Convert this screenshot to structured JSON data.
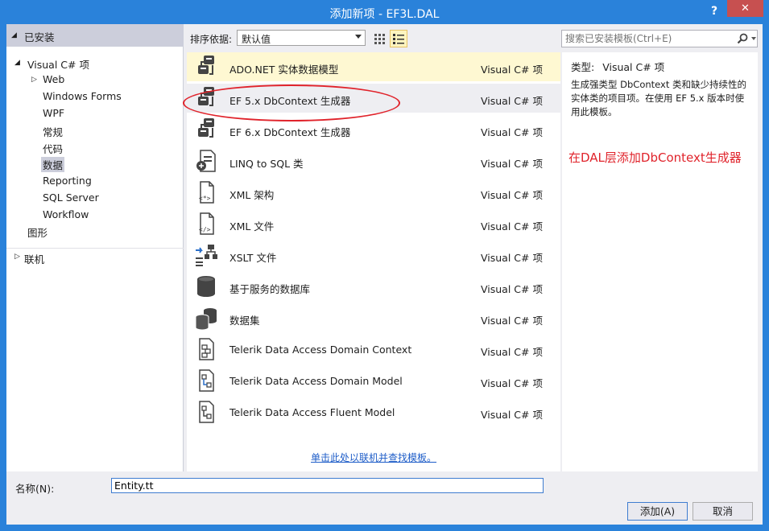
{
  "window": {
    "title": "添加新项 - EF3L.DAL",
    "help": "?",
    "close": "✕",
    "accent_color": "#2a82da"
  },
  "tree": {
    "installed_header": "已安装",
    "items": [
      {
        "label": "Visual C# 项",
        "expanded": true
      },
      {
        "label": "Web",
        "collapsed": true
      },
      {
        "label": "Windows Forms"
      },
      {
        "label": "WPF"
      },
      {
        "label": "常规"
      },
      {
        "label": "代码"
      },
      {
        "label": "数据",
        "selected": true
      },
      {
        "label": "Reporting"
      },
      {
        "label": "SQL Server"
      },
      {
        "label": "Workflow"
      },
      {
        "label": "图形"
      }
    ],
    "online_header": "联机"
  },
  "toolbar": {
    "sort_label": "排序依据:",
    "sort_value": "默认值",
    "search_placeholder": "搜索已安装模板(Ctrl+E)"
  },
  "templates": [
    {
      "name": "ADO.NET 实体数据模型",
      "lang": "Visual C# 项",
      "icon": "entity-model-icon"
    },
    {
      "name": "EF 5.x DbContext 生成器",
      "lang": "Visual C# 项",
      "icon": "dbcontext-generator-icon"
    },
    {
      "name": "EF 6.x DbContext 生成器",
      "lang": "Visual C# 项",
      "icon": "dbcontext-generator-icon"
    },
    {
      "name": "LINQ to SQL 类",
      "lang": "Visual C# 项",
      "icon": "linq-to-sql-icon"
    },
    {
      "name": "XML 架构",
      "lang": "Visual C# 项",
      "icon": "xml-schema-icon"
    },
    {
      "name": "XML 文件",
      "lang": "Visual C# 项",
      "icon": "xml-file-icon"
    },
    {
      "name": "XSLT 文件",
      "lang": "Visual C# 项",
      "icon": "xslt-file-icon"
    },
    {
      "name": "基于服务的数据库",
      "lang": "Visual C# 项",
      "icon": "database-icon"
    },
    {
      "name": "数据集",
      "lang": "Visual C# 项",
      "icon": "dataset-icon"
    },
    {
      "name": "Telerik Data Access Domain Context",
      "lang": "Visual C# 项",
      "icon": "domain-context-icon"
    },
    {
      "name": "Telerik Data Access Domain Model",
      "lang": "Visual C# 项",
      "icon": "domain-model-icon"
    },
    {
      "name": "Telerik Data Access Fluent Model",
      "lang": "Visual C# 项",
      "icon": "fluent-model-icon"
    }
  ],
  "online_link": "单击此处以联机并查找模板。",
  "description": {
    "type_label": "类型:",
    "type_value": "Visual C# 项",
    "text": "生成强类型 DbContext 类和缺少持续性的实体类的项目项。在使用 EF 5.x 版本时使用此模板。",
    "annotation": "在DAL层添加DbContext生成器",
    "annotation_color": "#e0232b"
  },
  "bottom": {
    "name_label": "名称(N):",
    "name_value": "Entity.tt",
    "add_button": "添加(A)",
    "cancel_button": "取消"
  }
}
